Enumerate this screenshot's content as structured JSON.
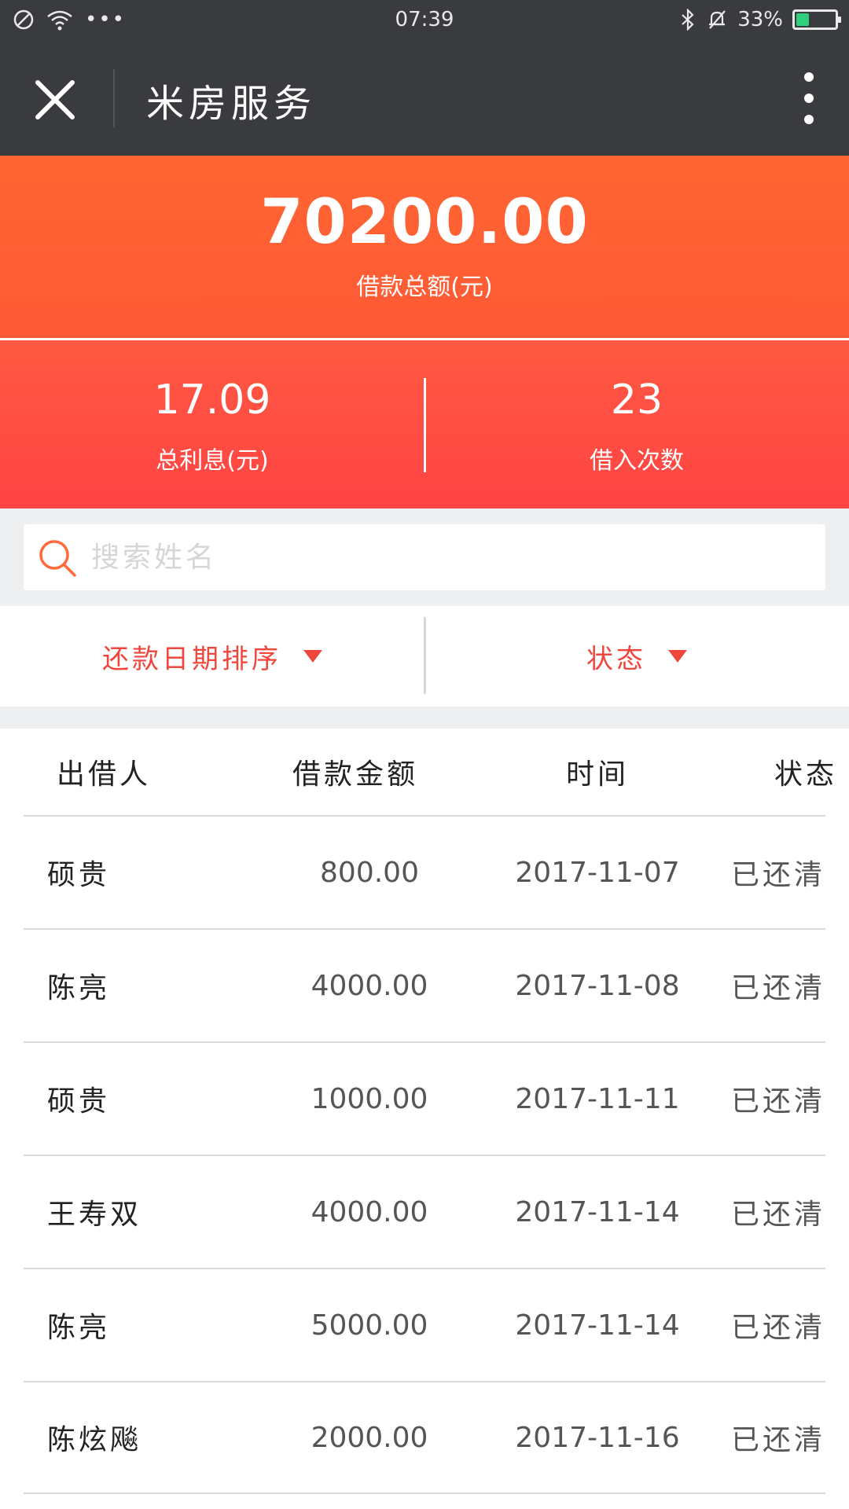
{
  "status_bar": {
    "time": "07:39",
    "battery": "33%",
    "battery_level": 0.33
  },
  "header": {
    "title": "米房服务"
  },
  "summary": {
    "total_amount": "70200.00",
    "total_label": "借款总额(元)",
    "interest_value": "17.09",
    "interest_label": "总利息(元)",
    "count_value": "23",
    "count_label": "借入次数"
  },
  "search": {
    "placeholder": "搜索姓名"
  },
  "filters": {
    "sort_label": "还款日期排序",
    "status_label": "状态"
  },
  "table": {
    "headers": [
      "出借人",
      "借款金额",
      "时间",
      "状态"
    ],
    "rows": [
      {
        "name": "硕贵",
        "amount": "800.00",
        "date": "2017-11-07",
        "status": "已还清"
      },
      {
        "name": "陈亮",
        "amount": "4000.00",
        "date": "2017-11-08",
        "status": "已还清"
      },
      {
        "name": "硕贵",
        "amount": "1000.00",
        "date": "2017-11-11",
        "status": "已还清"
      },
      {
        "name": "王寿双",
        "amount": "4000.00",
        "date": "2017-11-14",
        "status": "已还清"
      },
      {
        "name": "陈亮",
        "amount": "5000.00",
        "date": "2017-11-14",
        "status": "已还清"
      },
      {
        "name": "陈炫飚",
        "amount": "2000.00",
        "date": "2017-11-16",
        "status": "已还清"
      }
    ]
  },
  "colors": {
    "header_bg": "#3a3b3f",
    "accent_orange": "#ff6532",
    "accent_red": "#ff4444",
    "filter_text": "#f0473d"
  }
}
